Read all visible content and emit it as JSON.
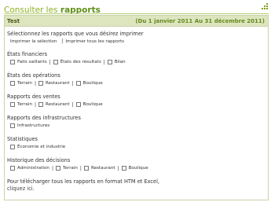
{
  "header": {
    "title_part1": "Consulter les",
    "title_part2": "rapports"
  },
  "panel": {
    "name": "Test",
    "date_range": "(Du 1 janvier 2011 Au 31 décembre 2011)"
  },
  "intro": {
    "title": "Sélectionnez les rapports que vous désirez imprimer",
    "print_selection": "Imprimer la sélection",
    "separator": "|",
    "print_all": "Imprimer tous les rapports"
  },
  "sections": {
    "financiers": {
      "title": "États financiers",
      "options": [
        "Faits saillants",
        "États des résultats",
        "Bilan"
      ]
    },
    "operations": {
      "title": "États des opérations",
      "options": [
        "Terrain",
        "Restaurant",
        "Boutique"
      ]
    },
    "ventes": {
      "title": "Rapports des ventes",
      "options": [
        "Terrain",
        "Restaurant",
        "Boutique"
      ]
    },
    "infrastructures": {
      "title": "Rapports des infrastructures",
      "options": [
        "Infrastructures"
      ]
    },
    "statistiques": {
      "title": "Statistiques",
      "options": [
        "Économie et industrie"
      ]
    },
    "historique": {
      "title": "Historique des décisions",
      "options": [
        "Administration",
        "Terrain",
        "Restaurant",
        "Boutique"
      ]
    }
  },
  "footer": {
    "line1": "Pour télécharger tous les rapports en format HTM et Excel,",
    "link": "cliquez ici",
    "after_link": "."
  },
  "colors": {
    "accent": "#8cb020",
    "header_bg": "#dde5bf"
  },
  "icons": {
    "resize": "resize-grip-icon"
  }
}
